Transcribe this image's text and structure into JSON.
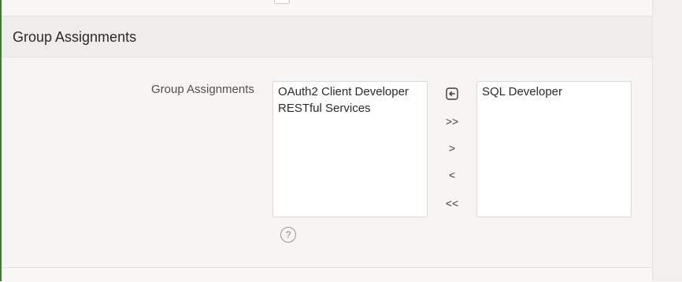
{
  "region": {
    "title": "Group Assignments"
  },
  "field": {
    "label": "Group Assignments",
    "available": [
      "OAuth2 Client Developer",
      "RESTful Services"
    ],
    "selected": [
      "SQL Developer"
    ]
  },
  "shuttle": {
    "reset_icon": "reset-icon",
    "move_all_label": ">>",
    "move_label": ">",
    "remove_label": "<",
    "remove_all_label": "<<"
  },
  "help": {
    "glyph": "?"
  }
}
